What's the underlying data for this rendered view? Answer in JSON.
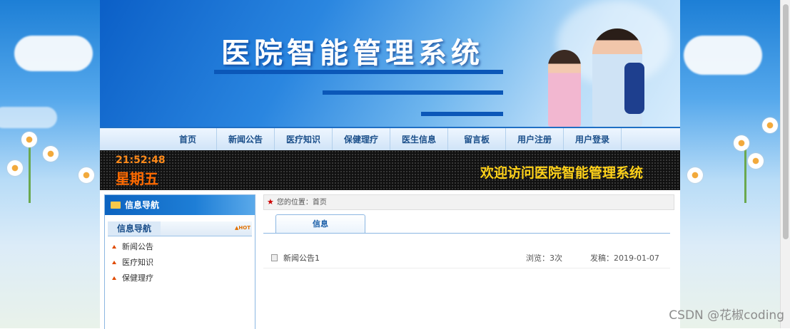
{
  "banner": {
    "title": "医院智能管理系统"
  },
  "nav": {
    "items": [
      "首页",
      "新闻公告",
      "医疗知识",
      "保健理疗",
      "医生信息",
      "留言板",
      "用户注册",
      "用户登录"
    ]
  },
  "clock": {
    "time": "21:52:48",
    "day": "星期五"
  },
  "welcome": "欢迎访问医院智能管理系统",
  "sidebar": {
    "header": "信息导航",
    "sub_label": "信息导航",
    "hot_label": "HOT",
    "items": [
      "新闻公告",
      "医疗知识",
      "保健理疗"
    ]
  },
  "breadcrumb": {
    "prefix": "您的位置：",
    "current": "首页"
  },
  "tab": {
    "label": "信息"
  },
  "list": [
    {
      "title": "新闻公告1",
      "views": "浏览：3次",
      "date": "发稿：2019-01-07"
    }
  ],
  "watermark": "CSDN @花椒coding",
  "colors": {
    "primary": "#0b5fc7",
    "nav_text": "#1b4f8a",
    "welcome": "#ffd21a",
    "clock": "#ff6a00"
  }
}
